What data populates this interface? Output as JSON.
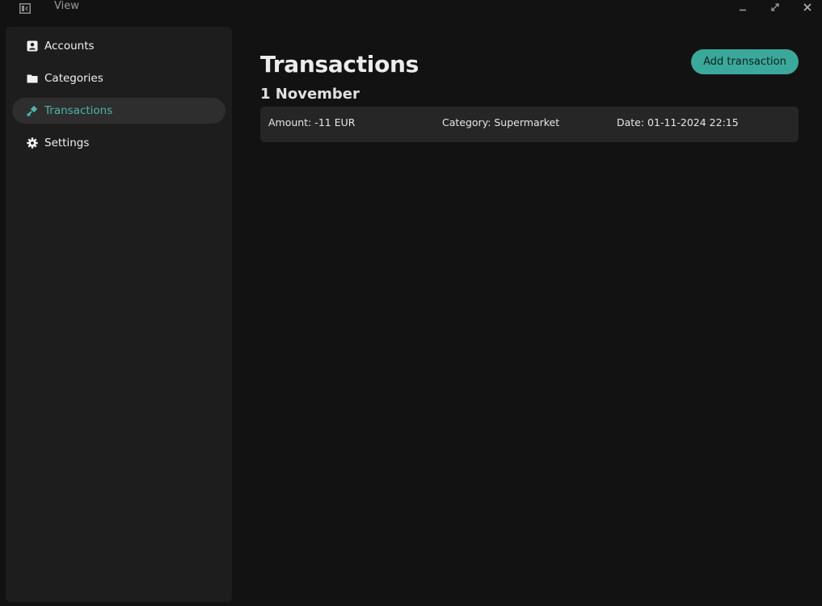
{
  "titlebar": {
    "menu_view": "View"
  },
  "sidebar": {
    "items": [
      {
        "label": "Accounts",
        "icon": "contact-card-icon",
        "active": false
      },
      {
        "label": "Categories",
        "icon": "folder-icon",
        "active": false
      },
      {
        "label": "Transactions",
        "icon": "transactions-icon",
        "active": true
      },
      {
        "label": "Settings",
        "icon": "gear-icon",
        "active": false
      }
    ]
  },
  "main": {
    "title": "Transactions",
    "add_button_label": "Add transaction",
    "groups": [
      {
        "heading": "1 November",
        "transactions": [
          {
            "amount": "Amount: -11 EUR",
            "category": "Category: Supermarket",
            "date": "Date: 01-11-2024 22:15"
          }
        ]
      }
    ]
  },
  "colors": {
    "accent": "#3aa89b",
    "accent_text": "#4fb5a8",
    "background": "#121212",
    "sidebar": "#1d1d1d",
    "row": "#262626"
  }
}
